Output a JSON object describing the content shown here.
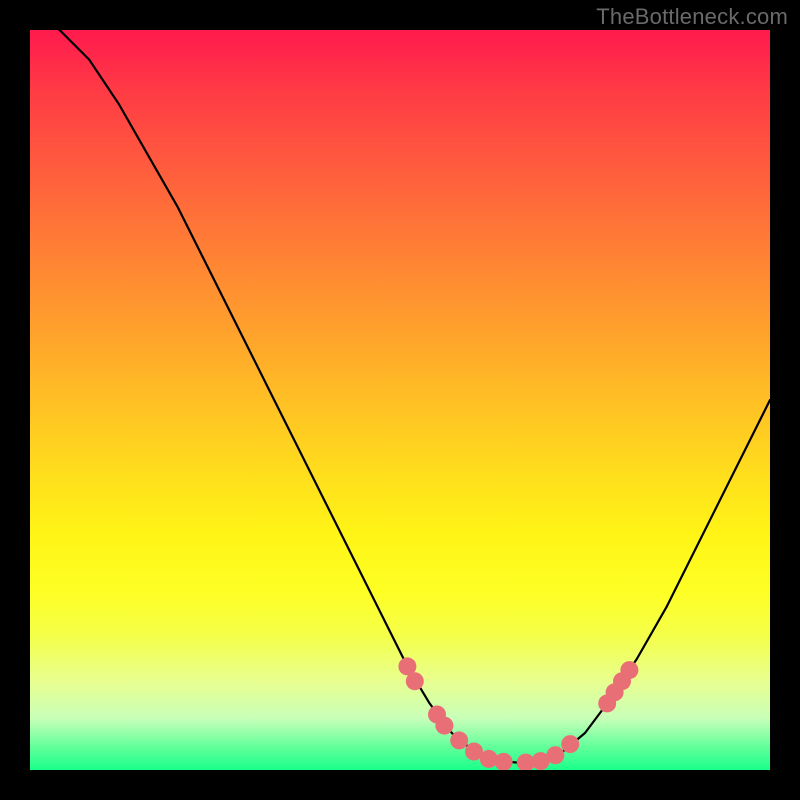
{
  "watermark": "TheBottleneck.com",
  "colors": {
    "curve_stroke": "#000000",
    "dot_fill": "#e96f77",
    "gradient_top": "#ff1a4d",
    "gradient_bottom": "#1aff8a",
    "background": "#000000"
  },
  "chart_data": {
    "type": "line",
    "title": "",
    "xlabel": "",
    "ylabel": "",
    "xlim": [
      0,
      100
    ],
    "ylim": [
      0,
      100
    ],
    "curve_points": [
      {
        "x": 0,
        "y": 103
      },
      {
        "x": 4,
        "y": 100
      },
      {
        "x": 8,
        "y": 96
      },
      {
        "x": 12,
        "y": 90
      },
      {
        "x": 16,
        "y": 83
      },
      {
        "x": 20,
        "y": 76
      },
      {
        "x": 24,
        "y": 68
      },
      {
        "x": 28,
        "y": 60
      },
      {
        "x": 32,
        "y": 52
      },
      {
        "x": 36,
        "y": 44
      },
      {
        "x": 40,
        "y": 36
      },
      {
        "x": 44,
        "y": 28
      },
      {
        "x": 48,
        "y": 20
      },
      {
        "x": 51,
        "y": 14
      },
      {
        "x": 54,
        "y": 9
      },
      {
        "x": 57,
        "y": 5
      },
      {
        "x": 60,
        "y": 2.5
      },
      {
        "x": 63,
        "y": 1.2
      },
      {
        "x": 66,
        "y": 1
      },
      {
        "x": 69,
        "y": 1.2
      },
      {
        "x": 72,
        "y": 2.5
      },
      {
        "x": 75,
        "y": 5
      },
      {
        "x": 78,
        "y": 9
      },
      {
        "x": 82,
        "y": 15
      },
      {
        "x": 86,
        "y": 22
      },
      {
        "x": 90,
        "y": 30
      },
      {
        "x": 95,
        "y": 40
      },
      {
        "x": 100,
        "y": 50
      }
    ],
    "dots_on_curve": [
      {
        "x": 51,
        "y": 14
      },
      {
        "x": 52,
        "y": 12
      },
      {
        "x": 55,
        "y": 7.5
      },
      {
        "x": 56,
        "y": 6
      },
      {
        "x": 58,
        "y": 4
      },
      {
        "x": 60,
        "y": 2.5
      },
      {
        "x": 62,
        "y": 1.5
      },
      {
        "x": 64,
        "y": 1.1
      },
      {
        "x": 67,
        "y": 1
      },
      {
        "x": 69,
        "y": 1.2
      },
      {
        "x": 71,
        "y": 2
      },
      {
        "x": 73,
        "y": 3.5
      },
      {
        "x": 78,
        "y": 9
      },
      {
        "x": 79,
        "y": 10.5
      },
      {
        "x": 80,
        "y": 12
      },
      {
        "x": 81,
        "y": 13.5
      }
    ]
  }
}
